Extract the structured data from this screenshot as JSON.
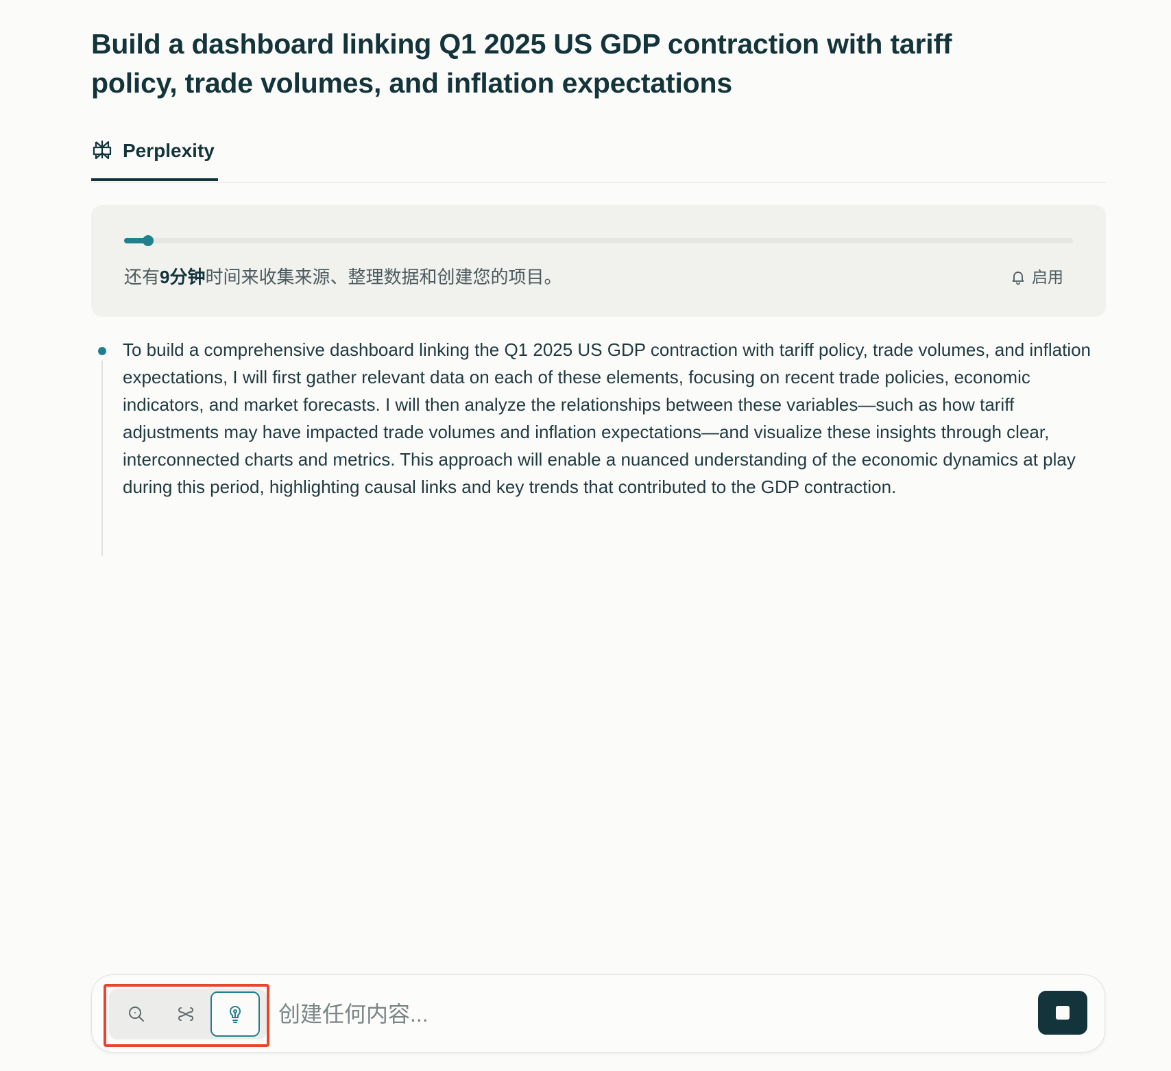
{
  "header": {
    "title": "Build a dashboard linking Q1 2025 US GDP contraction with tariff policy, trade volumes, and inflation expectations"
  },
  "tabs": [
    {
      "label": "Perplexity",
      "icon": "perplexity-logo-icon",
      "active": true
    }
  ],
  "progress": {
    "fraction": 0.025,
    "text_prefix": "还有",
    "text_bold": "9分钟",
    "text_suffix": "时间来收集来源、整理数据和创建您的项目。",
    "notify_label": "启用",
    "notify_icon": "bell-icon"
  },
  "steps": [
    {
      "text": "To build a comprehensive dashboard linking the Q1 2025 US GDP contraction with tariff policy, trade volumes, and inflation expectations, I will first gather relevant data on each of these elements, focusing on recent trade policies, economic indicators, and market forecasts. I will then analyze the relationships between these variables—such as how tariff adjustments may have impacted trade volumes and inflation expectations—and visualize these insights through clear, interconnected charts and metrics. This approach will enable a nuanced understanding of the economic dynamics at play during this period, highlighting causal links and key trends that contributed to the GDP contraction."
    }
  ],
  "composer": {
    "placeholder": "创建任何内容...",
    "modes": [
      {
        "icon": "search-icon",
        "active": false
      },
      {
        "icon": "research-icon",
        "active": false
      },
      {
        "icon": "lightbulb-icon",
        "active": true
      }
    ],
    "stop_icon": "stop-icon"
  },
  "colors": {
    "accent": "#20808d",
    "text": "#13343b",
    "background": "#fbfbf9",
    "highlight": "#e8442e"
  }
}
